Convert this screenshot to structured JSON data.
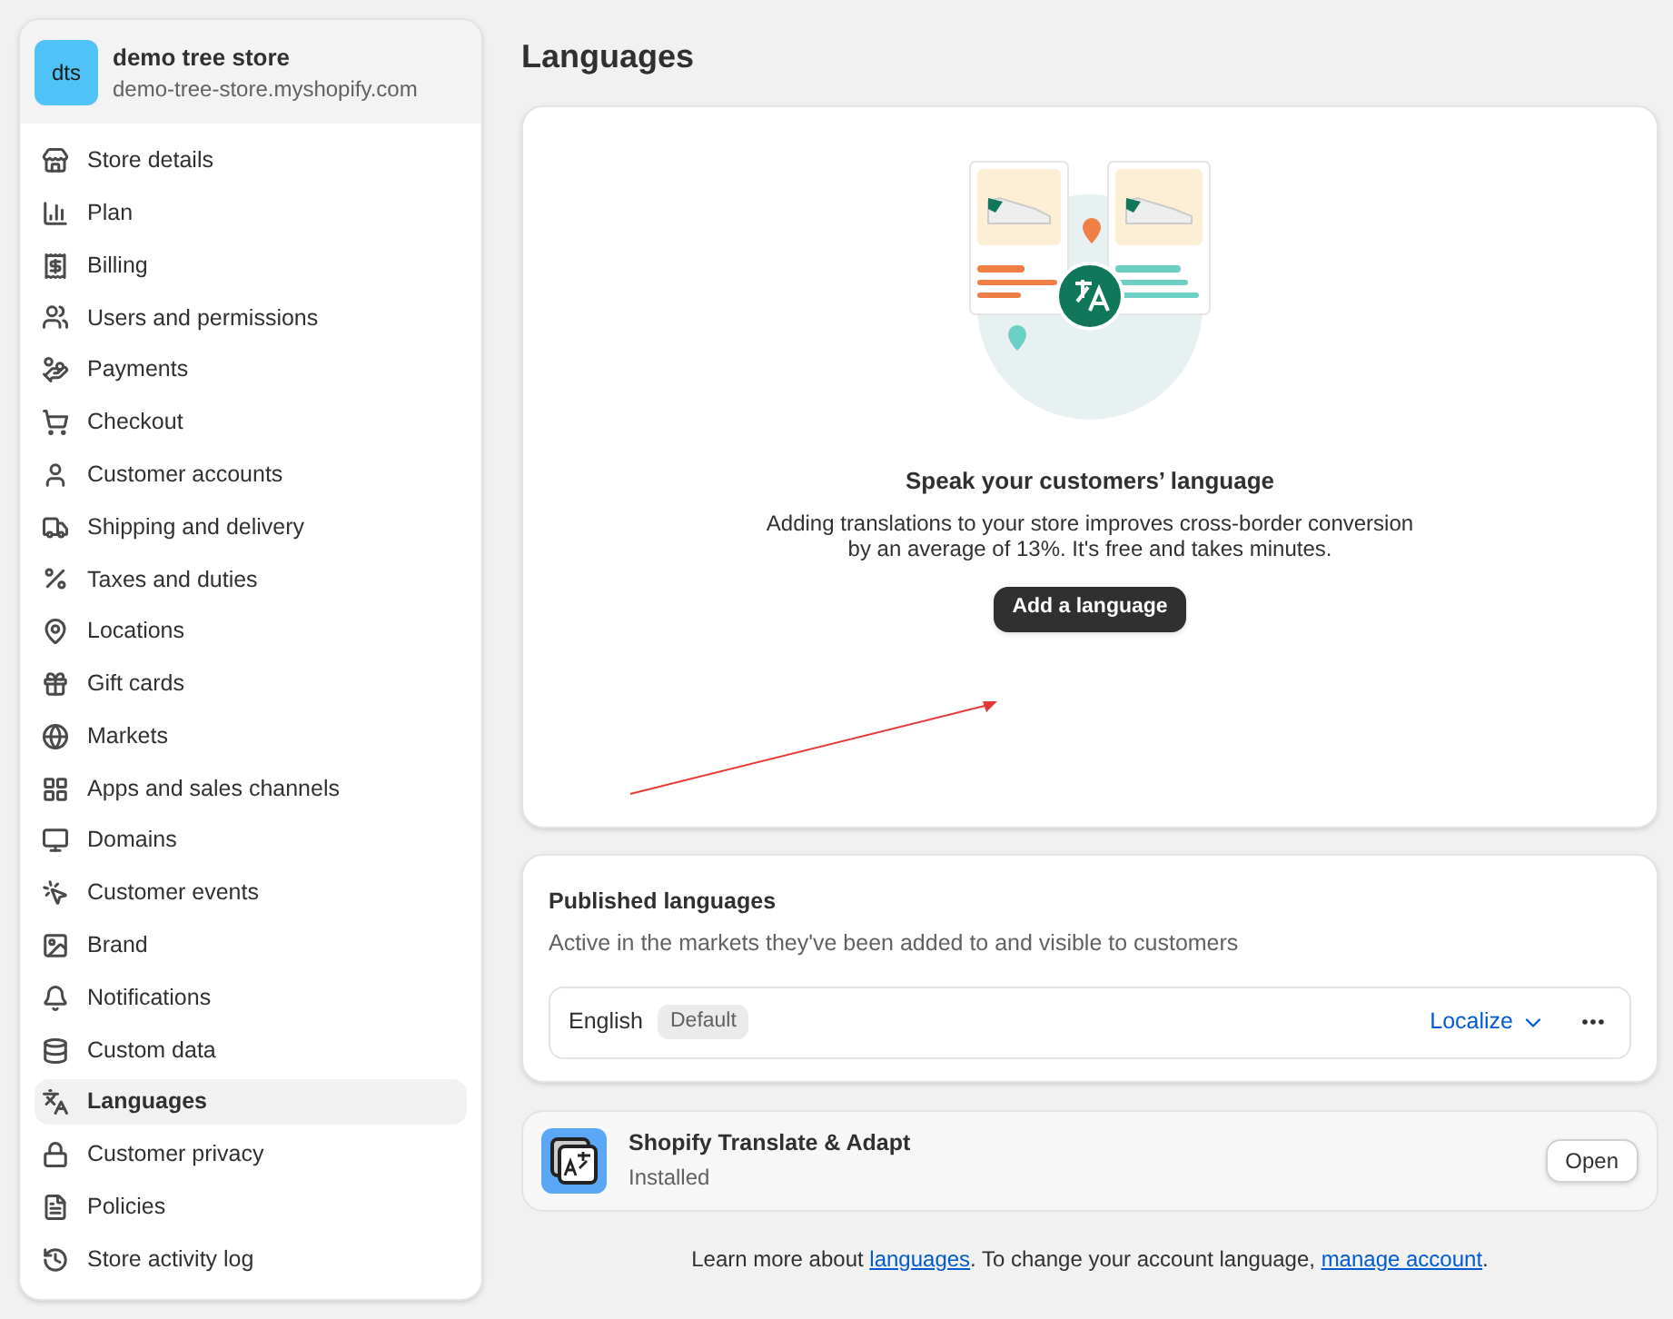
{
  "store": {
    "initials": "dts",
    "name": "demo tree store",
    "domain": "demo-tree-store.myshopify.com"
  },
  "sidebar": {
    "items": [
      {
        "label": "Store details",
        "selected": false
      },
      {
        "label": "Plan",
        "selected": false
      },
      {
        "label": "Billing",
        "selected": false
      },
      {
        "label": "Users and permissions",
        "selected": false
      },
      {
        "label": "Payments",
        "selected": false
      },
      {
        "label": "Checkout",
        "selected": false
      },
      {
        "label": "Customer accounts",
        "selected": false
      },
      {
        "label": "Shipping and delivery",
        "selected": false
      },
      {
        "label": "Taxes and duties",
        "selected": false
      },
      {
        "label": "Locations",
        "selected": false
      },
      {
        "label": "Gift cards",
        "selected": false
      },
      {
        "label": "Markets",
        "selected": false
      },
      {
        "label": "Apps and sales channels",
        "selected": false
      },
      {
        "label": "Domains",
        "selected": false
      },
      {
        "label": "Customer events",
        "selected": false
      },
      {
        "label": "Brand",
        "selected": false
      },
      {
        "label": "Notifications",
        "selected": false
      },
      {
        "label": "Custom data",
        "selected": false
      },
      {
        "label": "Languages",
        "selected": true
      },
      {
        "label": "Customer privacy",
        "selected": false
      },
      {
        "label": "Policies",
        "selected": false
      },
      {
        "label": "Store activity log",
        "selected": false
      }
    ]
  },
  "page_title": "Languages",
  "empty_state": {
    "heading": "Speak your customers’ language",
    "body": "Adding translations to your store improves cross-border conversion by an average of 13%. It's free and takes minutes.",
    "button": "Add a language"
  },
  "published": {
    "title": "Published languages",
    "subtitle": "Active in the markets they've been added to and visible to customers",
    "languages": [
      {
        "name": "English",
        "badge": "Default",
        "action": "Localize"
      }
    ]
  },
  "app": {
    "name": "Shopify Translate & Adapt",
    "status": "Installed",
    "button": "Open"
  },
  "footer": {
    "before": "Learn more about ",
    "link1": "languages",
    "middle": ". To change your account language, ",
    "link2": "manage account",
    "after": "."
  }
}
